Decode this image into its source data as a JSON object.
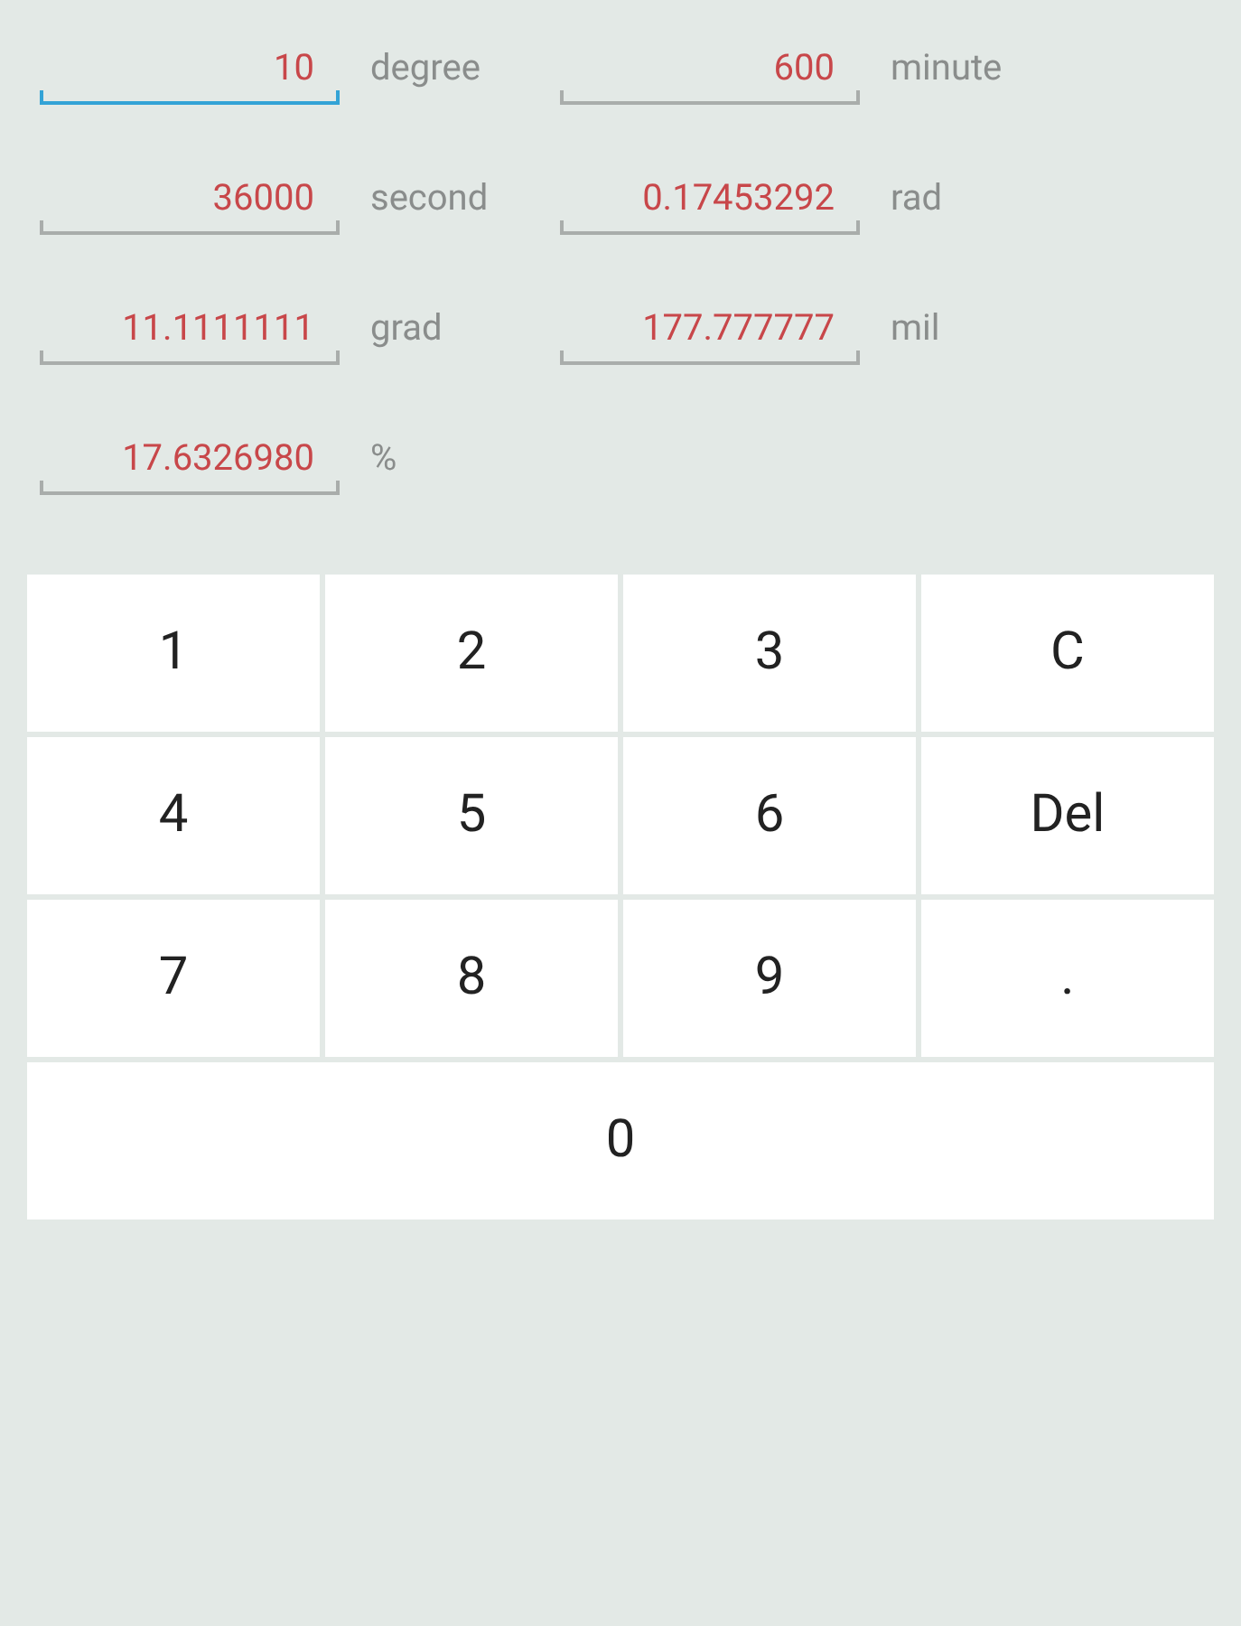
{
  "fields": [
    {
      "value": "10",
      "unit": "degree",
      "focused": true
    },
    {
      "value": "600",
      "unit": "minute",
      "focused": false
    },
    {
      "value": "36000",
      "unit": "second",
      "focused": false
    },
    {
      "value": "0.17453292",
      "unit": "rad",
      "focused": false
    },
    {
      "value": "11.1111111",
      "unit": "grad",
      "focused": false
    },
    {
      "value": "177.777777",
      "unit": "mil",
      "focused": false
    },
    {
      "value": "17.6326980",
      "unit": "%",
      "focused": false
    }
  ],
  "keys": [
    {
      "label": "1",
      "kind": "normal"
    },
    {
      "label": "2",
      "kind": "normal"
    },
    {
      "label": "3",
      "kind": "normal"
    },
    {
      "label": "C",
      "kind": "normal"
    },
    {
      "label": "4",
      "kind": "normal"
    },
    {
      "label": "5",
      "kind": "normal"
    },
    {
      "label": "6",
      "kind": "normal"
    },
    {
      "label": "Del",
      "kind": "normal"
    },
    {
      "label": "7",
      "kind": "normal"
    },
    {
      "label": "8",
      "kind": "normal"
    },
    {
      "label": "9",
      "kind": "normal"
    },
    {
      "label": ".",
      "kind": "normal"
    },
    {
      "label": "0",
      "kind": "wide"
    }
  ]
}
